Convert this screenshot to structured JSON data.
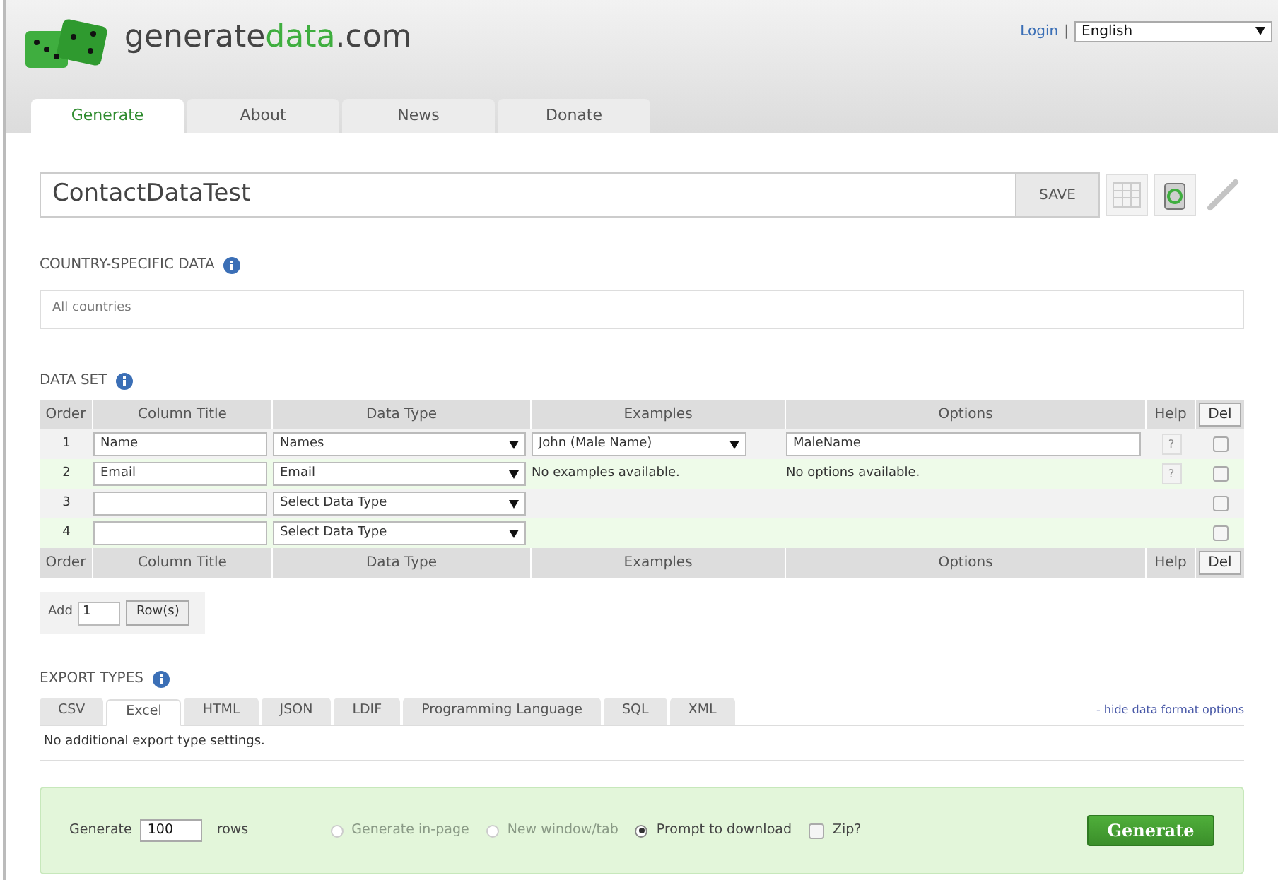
{
  "header": {
    "logo_text_1": "generate",
    "logo_text_2": "data",
    "logo_text_3": ".com",
    "login": "Login",
    "separator": "|",
    "language": "English"
  },
  "tabs": [
    {
      "label": "Generate",
      "selected": true
    },
    {
      "label": "About",
      "selected": false
    },
    {
      "label": "News",
      "selected": false
    },
    {
      "label": "Donate",
      "selected": false
    }
  ],
  "config": {
    "name": "ContactDataTest",
    "save": "SAVE"
  },
  "country": {
    "title": "COUNTRY-SPECIFIC DATA",
    "value": "All countries"
  },
  "data_set": {
    "title": "DATA SET",
    "columns": [
      "Order",
      "Column Title",
      "Data Type",
      "Examples",
      "Options",
      "Help",
      "Del"
    ],
    "rows": [
      {
        "order": "1",
        "title": "Name",
        "data_type": "Names",
        "examples": {
          "kind": "select",
          "text": "John (Male Name)"
        },
        "options": {
          "kind": "input",
          "text": "MaleName"
        },
        "help": "?",
        "checked": false
      },
      {
        "order": "2",
        "title": "Email",
        "data_type": "Email",
        "examples": {
          "kind": "text",
          "text": "No examples available."
        },
        "options": {
          "kind": "text",
          "text": "No options available."
        },
        "help": "?",
        "checked": false
      },
      {
        "order": "3",
        "title": "",
        "data_type": "Select Data Type",
        "checked": false
      },
      {
        "order": "4",
        "title": "",
        "data_type": "Select Data Type",
        "checked": false
      }
    ],
    "footer_columns": [
      "Order",
      "Column Title",
      "Data Type",
      "Examples",
      "Options",
      "Help",
      "Del"
    ],
    "add": {
      "label": "Add",
      "value": "1",
      "button": "Row(s)"
    }
  },
  "export": {
    "title": "EXPORT TYPES",
    "tabs": [
      {
        "label": "CSV",
        "selected": false
      },
      {
        "label": "Excel",
        "selected": true
      },
      {
        "label": "HTML",
        "selected": false
      },
      {
        "label": "JSON",
        "selected": false
      },
      {
        "label": "LDIF",
        "selected": false
      },
      {
        "label": "Programming Language",
        "selected": false
      },
      {
        "label": "SQL",
        "selected": false
      },
      {
        "label": "XML",
        "selected": false
      }
    ],
    "hide_link": "- hide data format options",
    "settings": "No additional export type settings."
  },
  "generate": {
    "label": "Generate",
    "count": "100",
    "rows": "rows",
    "radios": [
      {
        "label": "Generate in-page",
        "selected": false,
        "disabled": true
      },
      {
        "label": "New window/tab",
        "selected": false,
        "disabled": true
      },
      {
        "label": "Prompt to download",
        "selected": true,
        "disabled": false
      }
    ],
    "zip": {
      "label": "Zip?",
      "checked": false
    },
    "button": "Generate"
  }
}
